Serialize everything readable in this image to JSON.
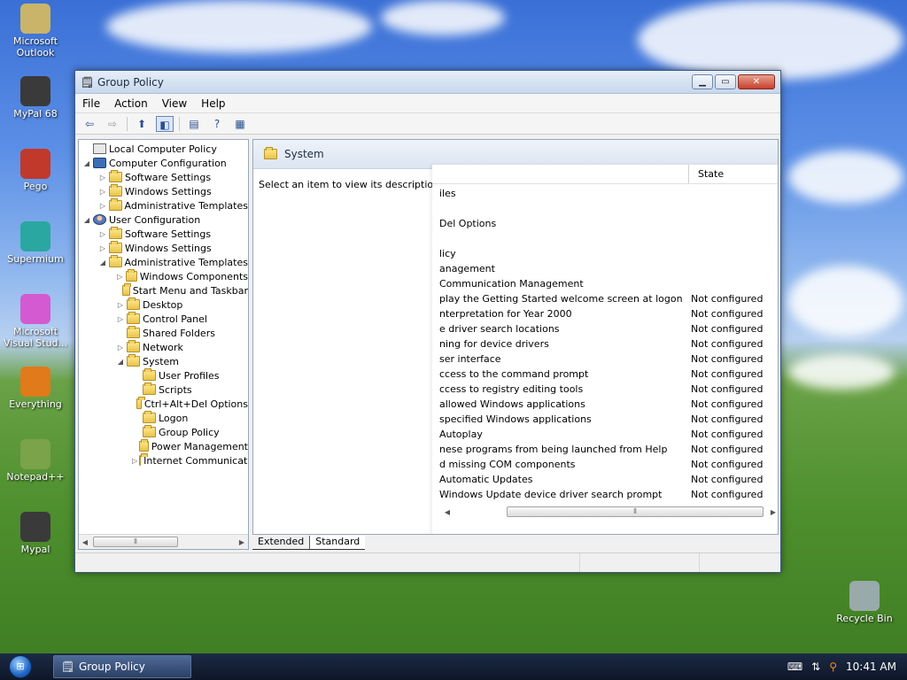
{
  "desktop": {
    "icons": [
      {
        "label": "Microsoft Outlook",
        "icon": "outlook-icon"
      },
      {
        "label": "MyPal 68",
        "icon": "mypal-icon"
      },
      {
        "label": "Pego",
        "icon": "pego-icon"
      },
      {
        "label": "Supermium",
        "icon": "supermium-icon"
      },
      {
        "label": "Microsoft Visual Stud...",
        "icon": "visual-studio-icon"
      },
      {
        "label": "Everything",
        "icon": "everything-icon"
      },
      {
        "label": "Notepad++",
        "icon": "notepad-plus-plus-icon"
      },
      {
        "label": "Mypal",
        "icon": "mypal-icon"
      },
      {
        "label": "Recycle Bin",
        "icon": "recycle-bin-icon"
      }
    ]
  },
  "window": {
    "title": "Group Policy",
    "menu": [
      "File",
      "Action",
      "View",
      "Help"
    ],
    "tree": [
      {
        "label": "Local Computer Policy",
        "icon": "policy",
        "exp": ""
      },
      {
        "label": "Computer Configuration",
        "icon": "computer",
        "exp": "◢"
      },
      {
        "label": "Software Settings",
        "icon": "folder",
        "exp": "▷"
      },
      {
        "label": "Windows Settings",
        "icon": "folder",
        "exp": "▷"
      },
      {
        "label": "Administrative Templates",
        "icon": "folder",
        "exp": "▷"
      },
      {
        "label": "User Configuration",
        "icon": "user",
        "exp": "◢"
      },
      {
        "label": "Software Settings",
        "icon": "folder",
        "exp": "▷"
      },
      {
        "label": "Windows Settings",
        "icon": "folder",
        "exp": "▷"
      },
      {
        "label": "Administrative Templates",
        "icon": "folder",
        "exp": "◢"
      },
      {
        "label": "Windows Components",
        "icon": "folder",
        "exp": "▷"
      },
      {
        "label": "Start Menu and Taskbar",
        "icon": "folder",
        "exp": ""
      },
      {
        "label": "Desktop",
        "icon": "folder",
        "exp": "▷"
      },
      {
        "label": "Control Panel",
        "icon": "folder",
        "exp": "▷"
      },
      {
        "label": "Shared Folders",
        "icon": "folder",
        "exp": ""
      },
      {
        "label": "Network",
        "icon": "folder",
        "exp": "▷"
      },
      {
        "label": "System",
        "icon": "folder",
        "exp": "◢"
      },
      {
        "label": "User Profiles",
        "icon": "folder",
        "exp": ""
      },
      {
        "label": "Scripts",
        "icon": "folder",
        "exp": ""
      },
      {
        "label": "Ctrl+Alt+Del Options",
        "icon": "folder",
        "exp": ""
      },
      {
        "label": "Logon",
        "icon": "folder",
        "exp": ""
      },
      {
        "label": "Group Policy",
        "icon": "folder",
        "exp": ""
      },
      {
        "label": "Power Management",
        "icon": "folder",
        "exp": ""
      },
      {
        "label": "Internet Communication",
        "icon": "folder",
        "exp": "▷"
      }
    ],
    "pane_title": "System",
    "description": "Select an item to view its description.",
    "list_header_state": "State",
    "settings": [
      {
        "setting": "iles",
        "state": ""
      },
      {
        "setting": "",
        "state": ""
      },
      {
        "setting": "Del Options",
        "state": ""
      },
      {
        "setting": "",
        "state": ""
      },
      {
        "setting": "licy",
        "state": ""
      },
      {
        "setting": "anagement",
        "state": ""
      },
      {
        "setting": "Communication Management",
        "state": ""
      },
      {
        "setting": "play the Getting Started welcome screen at logon",
        "state": "Not configured"
      },
      {
        "setting": "nterpretation for Year 2000",
        "state": "Not configured"
      },
      {
        "setting": "e driver search locations",
        "state": "Not configured"
      },
      {
        "setting": "ning for device drivers",
        "state": "Not configured"
      },
      {
        "setting": "ser interface",
        "state": "Not configured"
      },
      {
        "setting": "ccess to the command prompt",
        "state": "Not configured"
      },
      {
        "setting": "ccess to registry editing tools",
        "state": "Not configured"
      },
      {
        "setting": "allowed Windows applications",
        "state": "Not configured"
      },
      {
        "setting": "specified Windows applications",
        "state": "Not configured"
      },
      {
        "setting": "Autoplay",
        "state": "Not configured"
      },
      {
        "setting": "nese programs from being launched from Help",
        "state": "Not configured"
      },
      {
        "setting": "d missing COM components",
        "state": "Not configured"
      },
      {
        "setting": "Automatic Updates",
        "state": "Not configured"
      },
      {
        "setting": "Windows Update device driver search prompt",
        "state": "Not configured"
      }
    ],
    "tabs": [
      "Extended",
      "Standard"
    ]
  },
  "taskbar": {
    "task_label": "Group Policy",
    "clock": "10:41 AM"
  }
}
